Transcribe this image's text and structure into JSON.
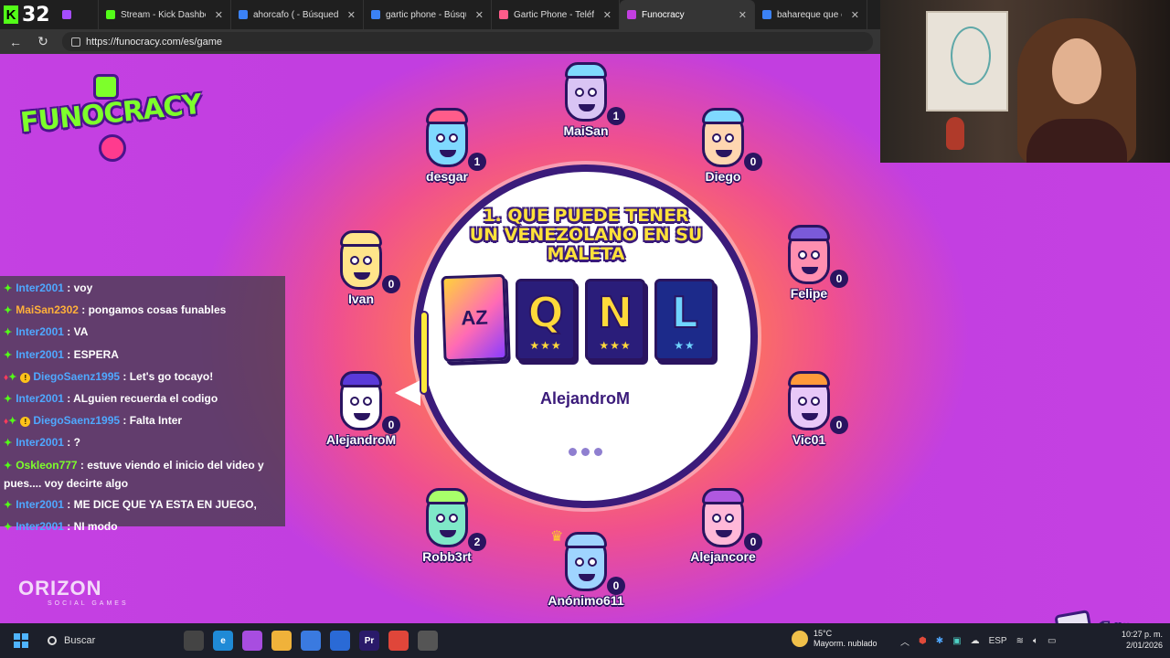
{
  "browser": {
    "kick_count": "32",
    "tabs": [
      {
        "label": "",
        "color": "#a64dff"
      },
      {
        "label": "Stream - Kick Dashboard",
        "color": "#53fc18"
      },
      {
        "label": "ahorcafo ( - Búsqueda",
        "color": "#3b82f6"
      },
      {
        "label": "gartic phone - Búsqueda",
        "color": "#3b82f6"
      },
      {
        "label": "Gartic Phone - Teléfono",
        "color": "#ff5c8a"
      },
      {
        "label": "Funocracy",
        "color": "#c23ee0",
        "active": true
      },
      {
        "label": "bahareque que es - Búsq",
        "color": "#3b82f6"
      }
    ],
    "close_glyph": "✕",
    "back_glyph": "←",
    "reload_glyph": "↻",
    "url": "https://funocracy.com/es/game"
  },
  "game": {
    "logo_text": "FUNOCRACY",
    "publisher": "ORIZON",
    "publisher_sub": "SOCIAL GAMES",
    "question": "1. QUE PUEDE TENER UN VENEZOLANO EN SU MALETA",
    "cards": [
      {
        "type": "az",
        "letter": "AZ",
        "stars": ""
      },
      {
        "type": "gold",
        "letter": "Q",
        "stars": "★★★"
      },
      {
        "type": "gold",
        "letter": "N",
        "stars": "★★★"
      },
      {
        "type": "blue",
        "letter": "L",
        "stars": "★★"
      }
    ],
    "current_player": "AlejandroM",
    "round": {
      "current": "1",
      "total": "/3",
      "icon_label": "AZ"
    },
    "players": [
      {
        "name": "MaiSan",
        "score": "1",
        "skin": "#d9c4f4",
        "hair": "#7fd9ff"
      },
      {
        "name": "desgar",
        "score": "1",
        "skin": "#7fd9ff",
        "hair": "#ff5c8a"
      },
      {
        "name": "Diego",
        "score": "0",
        "skin": "#ffd6b0",
        "hair": "#7fd9ff"
      },
      {
        "name": "Ivan",
        "score": "0",
        "skin": "#ffe58a",
        "hair": "#ffe58a"
      },
      {
        "name": "Felipe",
        "score": "0",
        "skin": "#ff8fb0",
        "hair": "#7a5ad9"
      },
      {
        "name": "AlejandroM",
        "score": "0",
        "skin": "#ffffff",
        "hair": "#5a3ad9"
      },
      {
        "name": "Vic01",
        "score": "0",
        "skin": "#e8c8f8",
        "hair": "#ff9a3a"
      },
      {
        "name": "Robb3rt",
        "score": "2",
        "skin": "#7fe8c8",
        "hair": "#a8ff6a"
      },
      {
        "name": "Alejancore",
        "score": "0",
        "skin": "#ffb8d8",
        "hair": "#b058e0"
      },
      {
        "name": "Anónimo611",
        "score": "0",
        "skin": "#9fd4ff",
        "hair": "#9fd4ff",
        "crown": "♛"
      }
    ]
  },
  "chat": [
    {
      "user": "Inter2001",
      "color": "#4fa8ff",
      "msg": " : voy",
      "badges": ""
    },
    {
      "user": "MaiSan2302",
      "color": "#ffb03a",
      "msg": " : pongamos cosas funables",
      "badges": ""
    },
    {
      "user": "Inter2001",
      "color": "#4fa8ff",
      "msg": " : VA",
      "badges": ""
    },
    {
      "user": "Inter2001",
      "color": "#4fa8ff",
      "msg": " : ESPERA",
      "badges": ""
    },
    {
      "user": "DiegoSaenz1995",
      "color": "#4fa8ff",
      "msg": " : Let's go tocayo!",
      "badges": "sub"
    },
    {
      "user": "Inter2001",
      "color": "#4fa8ff",
      "msg": " : ALguien recuerda el codigo",
      "badges": ""
    },
    {
      "user": "DiegoSaenz1995",
      "color": "#4fa8ff",
      "msg": " : Falta Inter",
      "badges": "sub"
    },
    {
      "user": "Inter2001",
      "color": "#4fa8ff",
      "msg": " : ?",
      "badges": ""
    },
    {
      "user": "Oskleon777",
      "color": "#7dff2b",
      "msg": " : estuve viendo el inicio del video y pues.... voy decirte algo",
      "badges": "",
      "wrap": true
    },
    {
      "user": "Inter2001",
      "color": "#4fa8ff",
      "msg": " : ME DICE QUE YA ESTA EN JUEGO,",
      "badges": ""
    },
    {
      "user": "Inter2001",
      "color": "#4fa8ff",
      "msg": " : NI modo",
      "badges": ""
    }
  ],
  "taskbar": {
    "search_label": "Buscar",
    "weather_temp": "15°C",
    "weather_desc": "Mayorm. nublado",
    "lang": "ESP",
    "time": "10:27 p. m.",
    "date": "2/01/2026",
    "apps": [
      {
        "label": "",
        "color": "#444"
      },
      {
        "label": "e",
        "color": "#1f8ad6"
      },
      {
        "label": "",
        "color": "#a84de0"
      },
      {
        "label": "",
        "color": "#f0b23a"
      },
      {
        "label": "",
        "color": "#3a7ae0"
      },
      {
        "label": "",
        "color": "#2a6ad6"
      },
      {
        "label": "Pr",
        "color": "#2a1a6a"
      },
      {
        "label": "",
        "color": "#e0463a"
      },
      {
        "label": "",
        "color": "#555"
      }
    ]
  }
}
